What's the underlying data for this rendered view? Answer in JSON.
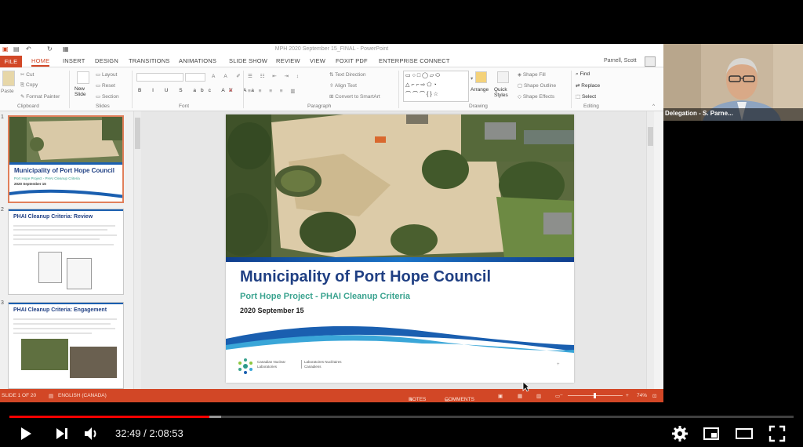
{
  "ppt": {
    "window_title": "MPH 2020 September 15_FINAL - PowerPoint",
    "tabs": [
      "FILE",
      "HOME",
      "INSERT",
      "DESIGN",
      "TRANSITIONS",
      "ANIMATIONS",
      "SLIDE SHOW",
      "REVIEW",
      "VIEW",
      "FOXIT PDF",
      "ENTERPRISE CONNECT"
    ],
    "active_tab": "HOME",
    "user": "Parnell, Scott",
    "ribbon": {
      "clipboard": {
        "paste": "Paste",
        "cut": "Cut",
        "copy": "Copy",
        "format_painter": "Format Painter",
        "group": "Clipboard"
      },
      "slides": {
        "new_slide": "New Slide",
        "layout": "Layout",
        "reset": "Reset",
        "section": "Section",
        "group": "Slides"
      },
      "font": {
        "group": "Font"
      },
      "paragraph": {
        "text_direction": "Text Direction",
        "align_text": "Align Text",
        "smartart": "Convert to SmartArt",
        "group": "Paragraph"
      },
      "drawing": {
        "arrange": "Arrange",
        "quick_styles": "Quick Styles",
        "shape_fill": "Shape Fill",
        "shape_outline": "Shape Outline",
        "shape_effects": "Shape Effects",
        "group": "Drawing"
      },
      "editing": {
        "find": "Find",
        "replace": "Replace",
        "select": "Select",
        "group": "Editing"
      }
    },
    "thumbnails": [
      {
        "num": "1",
        "title": "Municipality of Port Hope Council",
        "subtitle": "Port Hope Project - PHAI Cleanup Criteria",
        "date": "2020 September 15"
      },
      {
        "num": "2",
        "title": "PHAI Cleanup Criteria: Review"
      },
      {
        "num": "3",
        "title": "PHAI Cleanup Criteria: Engagement"
      }
    ],
    "slide": {
      "title": "Municipality of Port Hope Council",
      "subtitle": "Port Hope Project - PHAI Cleanup Criteria",
      "date": "2020 September 15",
      "org_en": "Canadian Nuclear Laboratories",
      "org_fr": "Laboratoires Nucléaires Canadiens"
    },
    "status": {
      "slide_info": "SLIDE 1 OF 20",
      "language": "ENGLISH (CANADA)",
      "notes": "NOTES",
      "comments": "COMMENTS",
      "zoom": "74%"
    }
  },
  "participant": {
    "label": "Delegation - S. Parne..."
  },
  "player": {
    "current_time": "32:49",
    "separator": " / ",
    "duration": "2:08:53",
    "progress_fraction": 0.255,
    "buffer_fraction": 0.27,
    "accent": "#ff0000"
  },
  "colors": {
    "ppt_accent": "#d24726",
    "title_blue": "#1f3f83",
    "subtitle_teal": "#3aa38f"
  }
}
